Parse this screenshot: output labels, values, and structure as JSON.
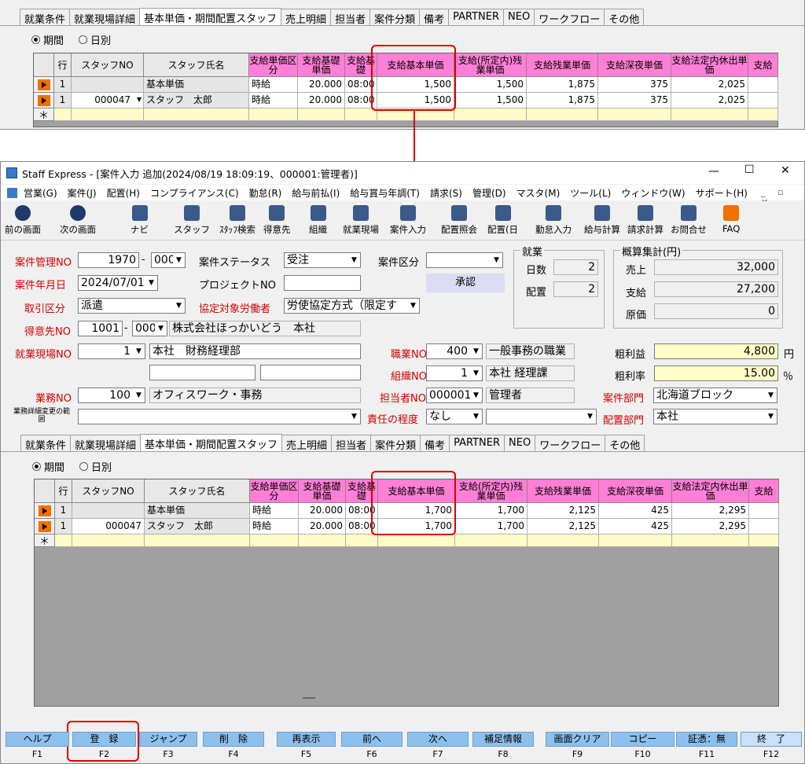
{
  "tabs": [
    "就業条件",
    "就業現場詳細",
    "基本単価・期間配置スタッフ",
    "売上明細",
    "担当者",
    "案件分類",
    "備考",
    "PARTNER",
    "NEO",
    "ワークフロー",
    "その他"
  ],
  "radio": {
    "period": "期間",
    "daily": "日別"
  },
  "grid_headers": [
    "行",
    "スタッフNO",
    "スタッフ氏名",
    "支給単価区分",
    "支給基礎単価",
    "支給基礎",
    "支給基本単価",
    "支給(所定内)残業単価",
    "支給残業単価",
    "支給深夜単価",
    "支給法定内休出単価",
    "支給"
  ],
  "top_rows": [
    {
      "row": "1",
      "staff_no": "",
      "name": "基本単価",
      "kubun": "時給",
      "kiso": "20.000",
      "time": "08:00",
      "kihon": "1,500",
      "shotei": "1,500",
      "zangyo": "1,875",
      "shinya": "375",
      "kyushutsu": "2,025"
    },
    {
      "row": "1",
      "staff_no": "000047",
      "name": "スタッフ　太郎",
      "kubun": "時給",
      "kiso": "20.000",
      "time": "08:00",
      "kihon": "1,500",
      "shotei": "1,500",
      "zangyo": "1,875",
      "shinya": "375",
      "kyushutsu": "2,025"
    }
  ],
  "new_row_marker": "＊",
  "window": {
    "title": "Staff Express - [案件入力 追加(2024/08/19 18:09:19、000001:管理者)]",
    "min": "—",
    "max": "☐",
    "close": "✕"
  },
  "menu": [
    "営業(G)",
    "案件(J)",
    "配置(H)",
    "コンプライアンス(C)",
    "勤怠(R)",
    "給与前払(I)",
    "給与賞与年調(T)",
    "請求(S)",
    "管理(D)",
    "マスタ(M)",
    "ツール(L)",
    "ウィンドウ(W)",
    "サポート(H)"
  ],
  "toolbar": [
    "前の画面",
    "次の画面",
    "ナビ",
    "スタッフ",
    "ｽﾀｯﾌ検索",
    "得意先",
    "組織",
    "就業現場",
    "案件入力",
    "配置照会",
    "配置(日",
    "勤怠入力",
    "給与計算",
    "請求計算",
    "お問合せ",
    "FAQ"
  ],
  "form": {
    "kanri_no_label": "案件管理NO",
    "kanri_no": "1970",
    "kanri_sub": "000",
    "status_label": "案件ステータス",
    "status": "受注",
    "kubun_label": "案件区分",
    "kubun": "",
    "ym_label": "案件年月日",
    "ym": "2024/07/01",
    "project_label": "プロジェクトNO",
    "project": "",
    "approve": "承認",
    "torihiki_label": "取引区分",
    "torihiki": "派遣",
    "kyotei_label": "協定対象労働者",
    "kyotei": "労使協定方式（限定す",
    "tokui_label": "得意先NO",
    "tokui_no": "1001",
    "tokui_sub": "000",
    "tokui_name": "株式会社ほっかいどう　本社",
    "genba_label": "就業現場NO",
    "genba_no": "1",
    "genba_name": "本社　財務経理部",
    "shokugyo_label": "職業NO",
    "shokugyo_no": "400",
    "shokugyo_name": "一般事務の職業",
    "soshiki_label": "組織NO",
    "soshiki_no": "1",
    "soshiki_name": "本社 経理課",
    "gyomu_label": "業務NO",
    "gyomu_no": "100",
    "gyomu_name": "オフィスワーク・事務",
    "tanto_label": "担当者NO",
    "tanto_no": "000001",
    "tanto_name": "管理者",
    "bumon_label": "案件部門",
    "bumon": "北海道ブロック",
    "gyomu_detail_label": "業務詳細変更の範囲",
    "sekinin_label": "責任の程度",
    "sekinin": "なし",
    "haichi_bumon_label": "配置部門",
    "haichi_bumon": "本社",
    "shugyo_title": "就業",
    "nissu_label": "日数",
    "nissu": "2",
    "haichi_label": "配置",
    "haichi": "2",
    "gaisan_title": "概算集計(円)",
    "uriage_label": "売上",
    "uriage": "32,000",
    "shikyu_label": "支給",
    "shikyu": "27,200",
    "genka_label": "原価",
    "genka": "0",
    "arari_label": "粗利益",
    "arari": "4,800",
    "arari_unit": "円",
    "rate_label": "粗利率",
    "rate": "15.00",
    "rate_unit": "％"
  },
  "bottom_rows": [
    {
      "row": "1",
      "staff_no": "",
      "name": "基本単価",
      "kubun": "時給",
      "kiso": "20.000",
      "time": "08:00",
      "kihon": "1,700",
      "shotei": "1,700",
      "zangyo": "2,125",
      "shinya": "425",
      "kyushutsu": "2,295"
    },
    {
      "row": "1",
      "staff_no": "000047",
      "name": "スタッフ　太郎",
      "kubun": "時給",
      "kiso": "20.000",
      "time": "08:00",
      "kihon": "1,700",
      "shotei": "1,700",
      "zangyo": "2,125",
      "shinya": "425",
      "kyushutsu": "2,295"
    }
  ],
  "fkeys": [
    {
      "label": "ヘルプ",
      "key": "F1"
    },
    {
      "label": "登　録",
      "key": "F2"
    },
    {
      "label": "ジャンプ",
      "key": "F3"
    },
    {
      "label": "削　除",
      "key": "F4"
    },
    {
      "label": "再表示",
      "key": "F5"
    },
    {
      "label": "前へ",
      "key": "F6"
    },
    {
      "label": "次へ",
      "key": "F7"
    },
    {
      "label": "補足情報",
      "key": "F8"
    },
    {
      "label": "画面クリア",
      "key": "F9"
    },
    {
      "label": "コピー",
      "key": "F10"
    },
    {
      "label": "証憑：無",
      "key": "F11"
    },
    {
      "label": "終　了",
      "key": "F12"
    }
  ],
  "colors": {
    "pink_header": "#ff7fd6",
    "highlight": "#e00000",
    "fkey": "#8ec0ec"
  }
}
